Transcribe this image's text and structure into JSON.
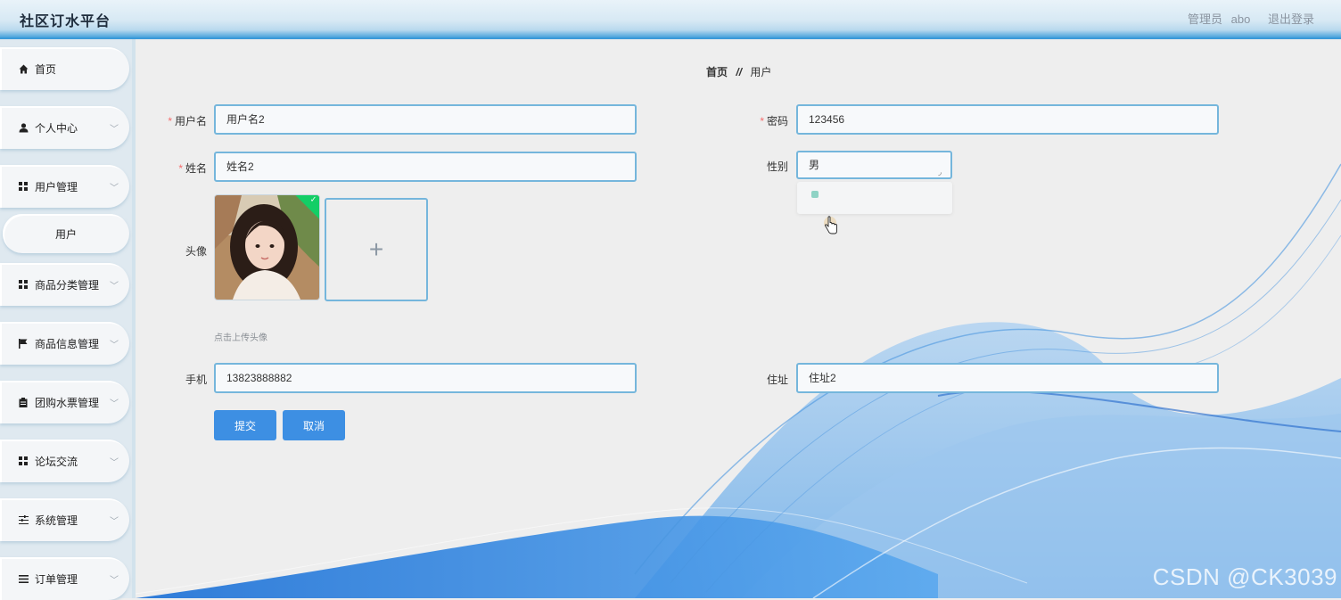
{
  "header": {
    "title": "社区订水平台",
    "user_role": "管理员",
    "username": "abo",
    "logout": "退出登录"
  },
  "sidebar": {
    "items": [
      {
        "label": "首页",
        "icon": "home-icon"
      },
      {
        "label": "个人中心",
        "icon": "user-icon"
      },
      {
        "label": "用户管理",
        "icon": "grid-icon"
      },
      {
        "label": "用户",
        "icon": ""
      },
      {
        "label": "商品分类管理",
        "icon": "grid-icon"
      },
      {
        "label": "商品信息管理",
        "icon": "flag-icon"
      },
      {
        "label": "团购水票管理",
        "icon": "clipboard-icon"
      },
      {
        "label": "论坛交流",
        "icon": "grid-icon"
      },
      {
        "label": "系统管理",
        "icon": "sliders-icon"
      },
      {
        "label": "订单管理",
        "icon": "list-icon"
      }
    ]
  },
  "breadcrumb": {
    "home": "首页",
    "separator": "//",
    "current": "用户"
  },
  "form": {
    "username_label": "用户名",
    "username_value": "用户名2",
    "password_label": "密码",
    "password_value": "123456",
    "name_label": "姓名",
    "name_value": "姓名2",
    "gender_label": "性别",
    "gender_value": "男",
    "avatar_label": "头像",
    "upload_tip": "点击上传头像",
    "phone_label": "手机",
    "phone_value": "13823888882",
    "address_label": "住址",
    "address_value": "住址2",
    "submit": "提交",
    "cancel": "取消"
  },
  "colors": {
    "primary": "#3d8fe3",
    "input_border": "#75b6dc",
    "required": "#f56c6c",
    "success": "#13ce66"
  },
  "watermark": "CSDN @CK3039"
}
